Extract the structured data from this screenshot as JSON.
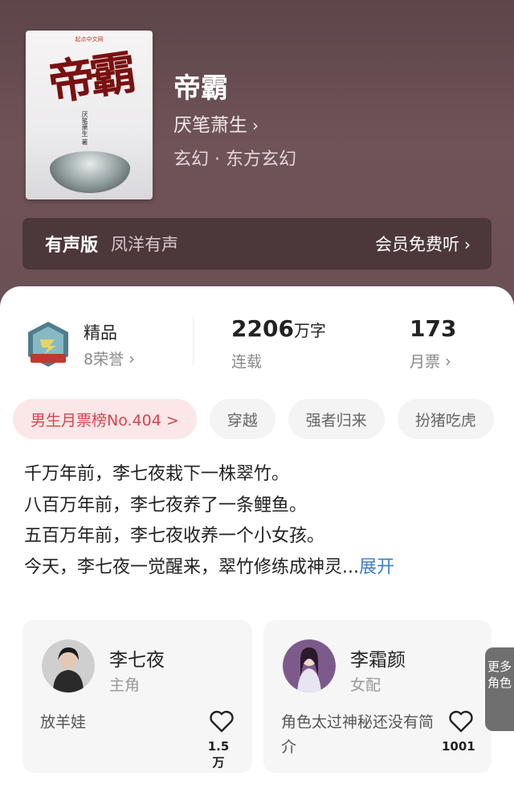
{
  "book": {
    "cover_publisher": "起点中文网",
    "cover_title": "帝霸",
    "cover_author": "厌笔萧生 著",
    "title": "帝霸",
    "author": "厌笔萧生",
    "genre": "玄幻 · 东方玄幻"
  },
  "audio": {
    "label": "有声版",
    "narrator": "凤洋有声",
    "free_listen": "会员免费听"
  },
  "stats": {
    "quality": "精品",
    "honors": "8荣誉",
    "word_count": "2206",
    "word_unit": "万字",
    "status": "连载",
    "votes": "173",
    "votes_label": "月票"
  },
  "tags": [
    "男生月票榜No.404 >",
    "穿越",
    "强者归来",
    "扮猪吃虎"
  ],
  "description": {
    "lines": [
      "千万年前，李七夜栽下一株翠竹。",
      "八百万年前，李七夜养了一条鲤鱼。",
      "五百万年前，李七夜收养一个小女孩。",
      "今天，李七夜一觉醒来，翠竹修练成神灵..."
    ],
    "expand": "展开"
  },
  "characters": [
    {
      "name": "李七夜",
      "role": "主角",
      "desc": "放羊娃",
      "likes": "1.5万"
    },
    {
      "name": "李霜颜",
      "role": "女配",
      "desc": "角色太过神秘还没有简介",
      "likes": "1001"
    }
  ],
  "more_roles": "更多角色",
  "colors": {
    "accent": "#d6434f",
    "link": "#3f7dc7",
    "hero_bg": "#6a5156"
  }
}
